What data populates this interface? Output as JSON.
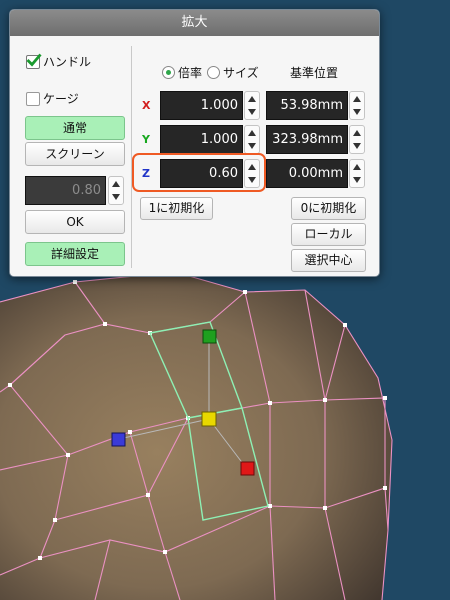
{
  "dialog": {
    "title": "拡大",
    "handle_label": "ハンドル",
    "handle_checked": true,
    "cage_label": "ケージ",
    "cage_checked": false,
    "mode_normal": "通常",
    "mode_screen": "スクリーン",
    "strength_value": "0.80",
    "ok_label": "OK",
    "advanced_label": "詳細設定",
    "radio_ratio": "倍率",
    "radio_size": "サイズ",
    "radio_selected": "倍率",
    "base_position_label": "基準位置",
    "axes": [
      {
        "label": "X",
        "color": "#d21e1e",
        "ratio": "1.000",
        "position": "53.98mm"
      },
      {
        "label": "Y",
        "color": "#17a81f",
        "ratio": "1.000",
        "position": "323.98mm"
      },
      {
        "label": "Z",
        "color": "#2034c8",
        "ratio": "0.60",
        "position": "0.00mm"
      }
    ],
    "init_one_label": "1に初期化",
    "init_zero_label": "0に初期化",
    "local_label": "ローカル",
    "select_center_label": "選択中心",
    "highlight_color": "#ef5a24"
  },
  "viewport": {
    "background_color": "#1f4864",
    "mesh_color": "#eb91c3",
    "selection_color": "#8ef0b4",
    "handle_colors": {
      "center": "#e8d800",
      "x": "#e01818",
      "y": "#1fa01f",
      "z": "#3a3ad8"
    }
  }
}
